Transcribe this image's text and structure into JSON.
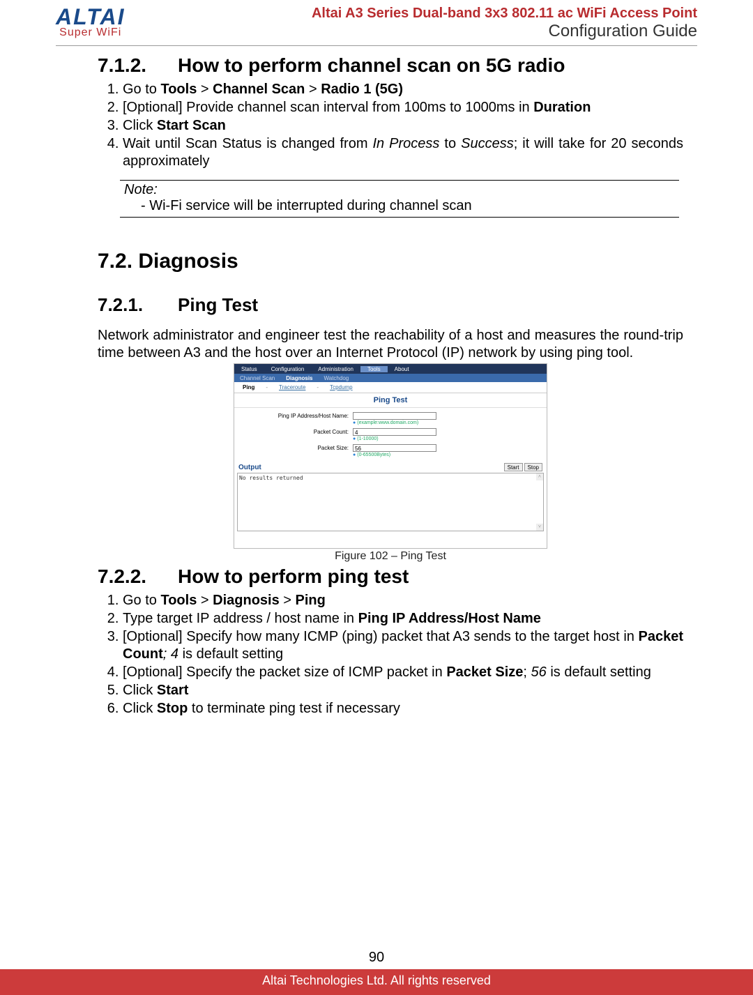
{
  "header": {
    "logo_main": "ALTAI",
    "logo_sub": "Super WiFi",
    "product": "Altai A3 Series Dual-band 3x3 802.11 ac WiFi Access Point",
    "guide": "Configuration Guide"
  },
  "sec712": {
    "num": "7.1.2.",
    "title": "How to perform channel scan on 5G radio",
    "steps": {
      "s1_a": "Go to ",
      "s1_b": "Tools",
      "s1_c": " > ",
      "s1_d": "Channel Scan",
      "s1_e": " > ",
      "s1_f": "Radio 1 (5G)",
      "s2_a": "[Optional] Provide channel scan interval from 100ms to 1000ms in ",
      "s2_b": "Duration",
      "s3_a": "Click ",
      "s3_b": "Start Scan",
      "s4_a": "Wait until Scan Status is changed from ",
      "s4_b": "In Process",
      "s4_c": " to ",
      "s4_d": "Success",
      "s4_e": "; it will take for 20 seconds approximately"
    },
    "note_title": "Note:",
    "note_body": "-  Wi-Fi service will be interrupted during channel scan"
  },
  "sec72": {
    "title": "7.2. Diagnosis"
  },
  "sec721": {
    "num": "7.2.1.",
    "title": "Ping Test",
    "para": "Network administrator and engineer test the reachability of a host and measures the round-trip time between A3 and the host over an Internet Protocol (IP) network by using ping tool."
  },
  "figure": {
    "tabs1": {
      "status": "Status",
      "config": "Configuration",
      "admin": "Administration",
      "tools": "Tools",
      "about": "About"
    },
    "tabs2": {
      "chscan": "Channel Scan",
      "diag": "Diagnosis",
      "watchdog": "Watchdog"
    },
    "subtabs": {
      "ping": "Ping",
      "trace": "Traceroute",
      "sep": "-",
      "tcpdump": "Tcpdump"
    },
    "title": "Ping Test",
    "form": {
      "ip_label": "Ping IP Address/Host Name:",
      "ip_hint": "(example:www.domain.com)",
      "count_label": "Packet Count:",
      "count_value": "4",
      "count_hint": "(1-10000)",
      "size_label": "Packet Size:",
      "size_value": "56",
      "size_hint": "(0-65500Bytes)"
    },
    "output_label": "Output",
    "btn_start": "Start",
    "btn_stop": "Stop",
    "console": "No results returned",
    "caption": "Figure 102 – Ping Test"
  },
  "sec722": {
    "num": "7.2.2.",
    "title": "How to perform ping test",
    "steps": {
      "s1_a": "Go to ",
      "s1_b": "Tools",
      "s1_c": " > ",
      "s1_d": "Diagnosis",
      "s1_e": " > ",
      "s1_f": "Ping",
      "s2_a": "Type target IP address / host name in ",
      "s2_b": "Ping IP Address/Host Name",
      "s3_a": "[Optional] Specify how many ICMP (ping) packet that A3 sends to the target host in ",
      "s3_b": "Packet Count",
      "s3_c": "; ",
      "s3_d": "4",
      "s3_e": " is default setting",
      "s4_a": "[Optional] Specify the packet size of ICMP packet in ",
      "s4_b": "Packet Size",
      "s4_c": "; ",
      "s4_d": "56",
      "s4_e": " is default setting",
      "s5_a": "Click ",
      "s5_b": "Start",
      "s6_a": "Click ",
      "s6_b": "Stop",
      "s6_c": " to terminate ping test if necessary"
    }
  },
  "page_number": "90",
  "footer": "Altai Technologies Ltd. All rights reserved"
}
